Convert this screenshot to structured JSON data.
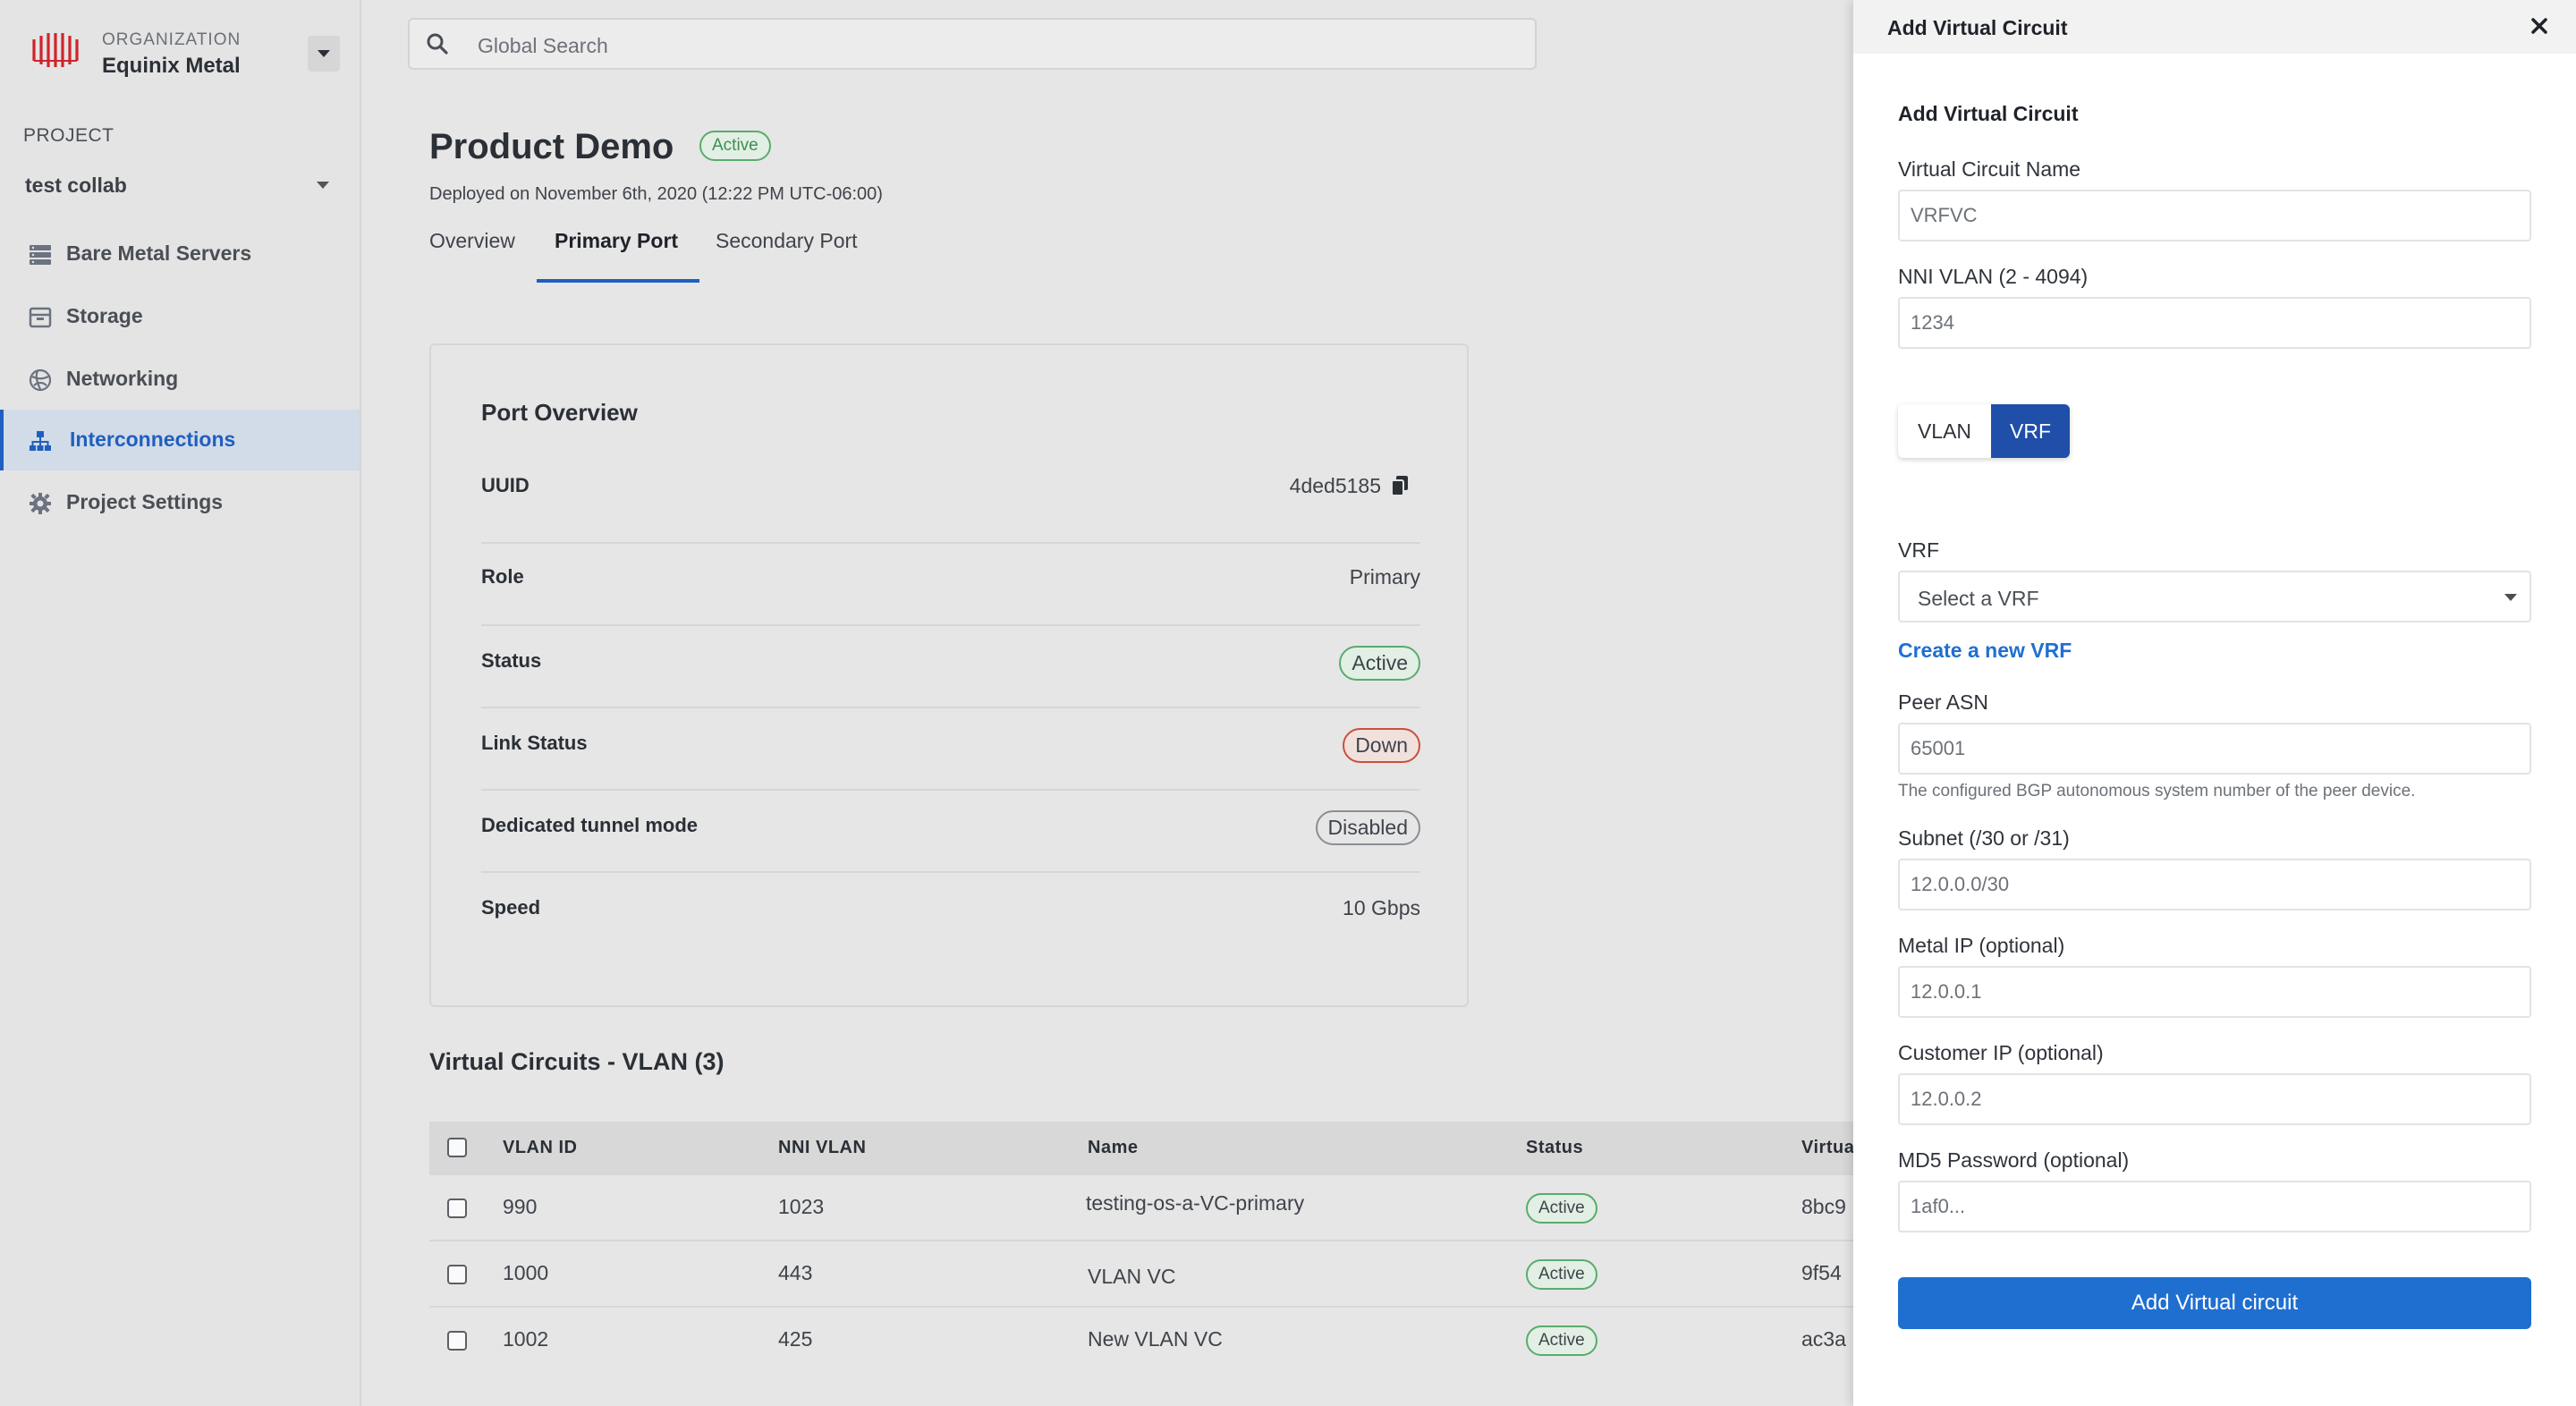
{
  "sidebar": {
    "org_label": "ORGANIZATION",
    "org_name": "Equinix Metal",
    "project_label": "PROJECT",
    "project_name": "test collab",
    "items": [
      {
        "label": "Bare Metal Servers",
        "icon": "server-icon"
      },
      {
        "label": "Storage",
        "icon": "storage-icon"
      },
      {
        "label": "Networking",
        "icon": "globe-icon"
      },
      {
        "label": "Interconnections",
        "icon": "network-tree-icon",
        "active": true
      },
      {
        "label": "Project Settings",
        "icon": "gear-icon"
      }
    ]
  },
  "search": {
    "placeholder": "Global Search"
  },
  "header": {
    "title": "Product Demo",
    "status": "Active",
    "deployed": "Deployed on November 6th, 2020 (12:22 PM UTC-06:00)",
    "tabs": [
      "Overview",
      "Primary Port",
      "Secondary Port"
    ],
    "active_tab": "Primary Port"
  },
  "port_overview": {
    "title": "Port Overview",
    "rows": [
      {
        "label": "UUID",
        "value": "4ded5185"
      },
      {
        "label": "Role",
        "value": "Primary"
      },
      {
        "label": "Status",
        "value": "Active"
      },
      {
        "label": "Link Status",
        "value": "Down"
      },
      {
        "label": "Dedicated tunnel mode",
        "value": "Disabled"
      },
      {
        "label": "Speed",
        "value": "10 Gbps"
      }
    ]
  },
  "virtual_circuits": {
    "title": "Virtual Circuits - VLAN (3)",
    "columns": [
      "VLAN ID",
      "NNI VLAN",
      "Name",
      "Status",
      "Virtua"
    ],
    "rows": [
      {
        "vlan_id": "990",
        "nni_vlan": "1023",
        "name": "testing-os-a-VC-primary",
        "status": "Active",
        "virtual": "8bc9"
      },
      {
        "vlan_id": "1000",
        "nni_vlan": "443",
        "name": "VLAN VC",
        "status": "Active",
        "virtual": "9f54"
      },
      {
        "vlan_id": "1002",
        "nni_vlan": "425",
        "name": "New VLAN VC",
        "status": "Active",
        "virtual": "ac3a"
      }
    ]
  },
  "drawer": {
    "title": "Add Virtual Circuit",
    "form_title": "Add Virtual Circuit",
    "vc_name_label": "Virtual Circuit Name",
    "vc_name_value": "VRFVC",
    "nni_vlan_label": "NNI VLAN (2 - 4094)",
    "nni_vlan_value": "1234",
    "toggle": {
      "options": [
        "VLAN",
        "VRF"
      ],
      "selected": "VRF"
    },
    "vrf_label": "VRF",
    "vrf_select": "Select a VRF",
    "create_vrf": "Create a new VRF",
    "peer_asn_label": "Peer ASN",
    "peer_asn_value": "65001",
    "peer_asn_hint": "The configured BGP autonomous system number of the peer device.",
    "subnet_label": "Subnet (/30 or /31)",
    "subnet_value": "12.0.0.0/30",
    "metal_ip_label": "Metal IP (optional)",
    "metal_ip_value": "12.0.0.1",
    "customer_ip_label": "Customer IP (optional)",
    "customer_ip_value": "12.0.0.2",
    "md5_label": "MD5 Password (optional)",
    "md5_value": "1af0...",
    "submit_label": "Add Virtual circuit"
  },
  "colors": {
    "accent": "#1f6fd0",
    "active_green": "#3d8f52",
    "down_red": "#b8432f",
    "brand_red": "#d2232a"
  }
}
